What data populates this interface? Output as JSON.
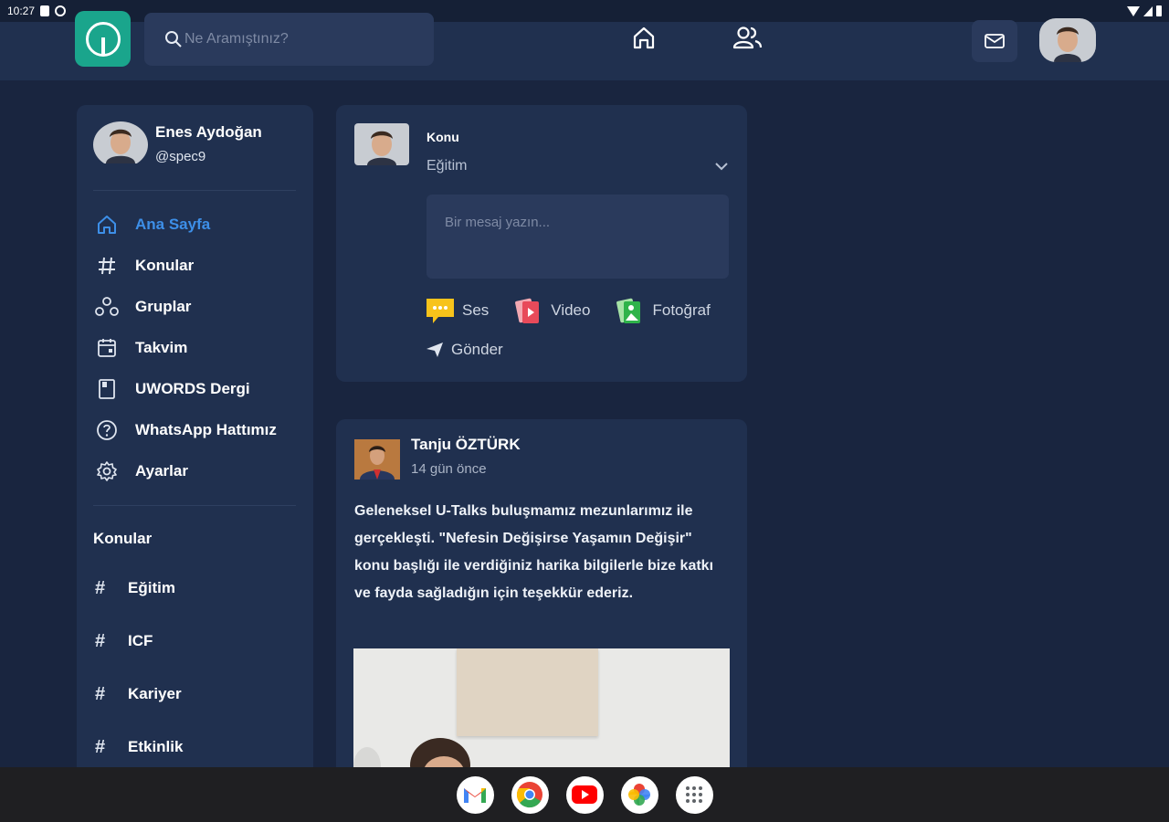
{
  "statusbar": {
    "time": "10:27"
  },
  "header": {
    "search_placeholder": "Ne Aramıştınız?"
  },
  "profile": {
    "name": "Enes Aydoğan",
    "handle": "@spec9"
  },
  "menu": [
    {
      "label": "Ana Sayfa",
      "icon": "home-icon",
      "active": true
    },
    {
      "label": "Konular",
      "icon": "hash-icon"
    },
    {
      "label": "Gruplar",
      "icon": "groups-icon"
    },
    {
      "label": "Takvim",
      "icon": "calendar-icon"
    },
    {
      "label": "UWORDS Dergi",
      "icon": "magazine-icon"
    },
    {
      "label": "WhatsApp Hattımız",
      "icon": "help-icon"
    },
    {
      "label": "Ayarlar",
      "icon": "settings-icon"
    }
  ],
  "topics_title": "Konular",
  "topics": [
    {
      "label": "Eğitim"
    },
    {
      "label": "ICF"
    },
    {
      "label": "Kariyer"
    },
    {
      "label": "Etkinlik"
    }
  ],
  "composer": {
    "label": "Konu",
    "selected_topic": "Eğitim",
    "placeholder": "Bir mesaj yazın...",
    "actions": {
      "audio": "Ses",
      "video": "Video",
      "photo": "Fotoğraf"
    },
    "send": "Gönder"
  },
  "post": {
    "author": "Tanju ÖZTÜRK",
    "time": "14 gün önce",
    "text": "Geleneksel U-Talks buluşmamız mezunlarımız ile gerçekleşti. \"Nefesin Değişirse Yaşamın Değişir\" konu başlığı ile verdiğiniz harika bilgilerle bize katkı ve fayda sağladığın için teşekkür ederiz."
  },
  "dock": [
    "gmail-icon",
    "chrome-icon",
    "youtube-icon",
    "photos-icon",
    "apps-icon"
  ],
  "colors": {
    "accent": "#3d8fe8",
    "logo": "#1aa58c",
    "background": "#19253f",
    "card": "#20304f"
  }
}
